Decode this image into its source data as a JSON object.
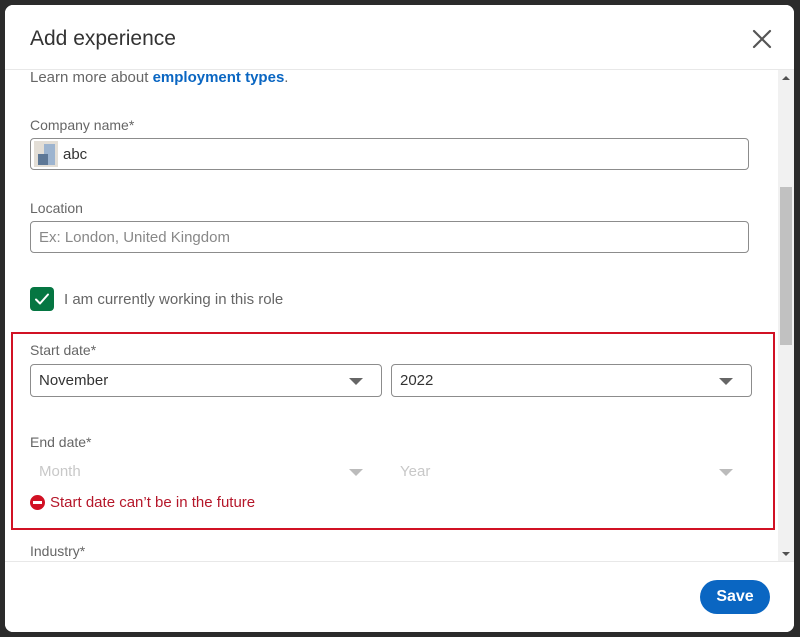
{
  "modal": {
    "title": "Add experience",
    "close_icon": "close-icon"
  },
  "form": {
    "learn_more_prefix": "Learn more about ",
    "learn_more_link": "employment types",
    "learn_more_suffix": ".",
    "company": {
      "label": "Company name*",
      "value": "abc"
    },
    "location": {
      "label": "Location",
      "value": "",
      "placeholder": "Ex: London, United Kingdom"
    },
    "currently_working": {
      "label": "I am currently working in this role",
      "checked": true
    },
    "start_date": {
      "label": "Start date*",
      "month": "November",
      "year": "2022"
    },
    "end_date": {
      "label": "End date*",
      "month_placeholder": "Month",
      "year_placeholder": "Year",
      "disabled": true
    },
    "error": "Start date can’t be in the future",
    "industry": {
      "label": "Industry*"
    }
  },
  "footer": {
    "save_label": "Save"
  },
  "colors": {
    "primary": "#0a66c2",
    "checkbox": "#057642",
    "error": "#d11124"
  }
}
